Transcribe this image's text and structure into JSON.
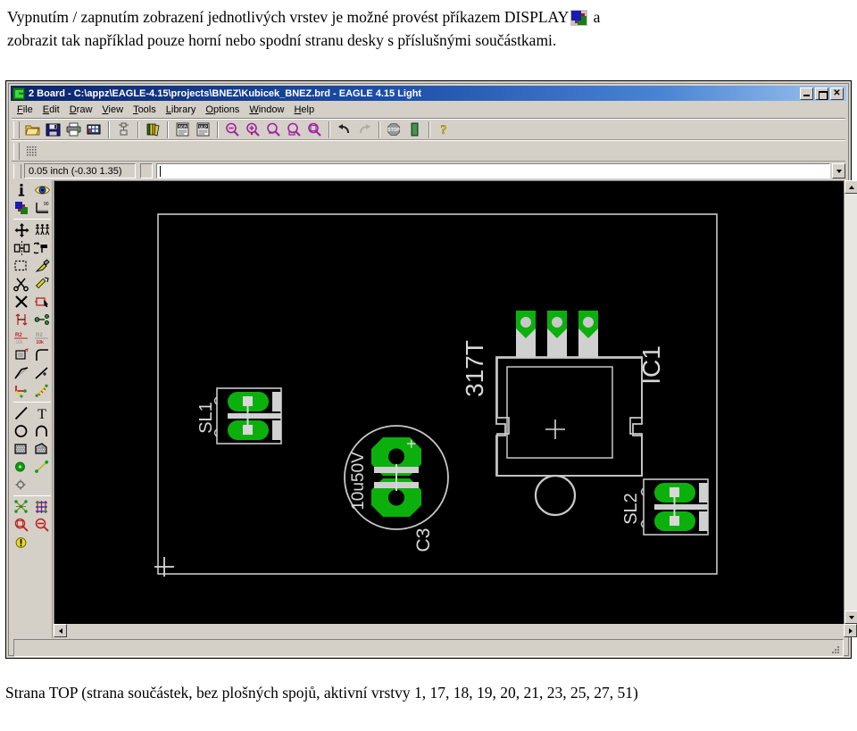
{
  "document": {
    "intro_text_line1": "Vypnutím / zapnutím zobrazení jednotlivých vrstev je možné provést příkazem DISPLAY",
    "intro_text_after_icon": " a",
    "intro_text_line2": "zobrazit tak například pouze horní nebo spodní stranu desky s příslušnými součástkami.",
    "caption_bottom": "Strana TOP (strana součástek, bez plošných spojů, aktivní vrstvy 1, 17, 18, 19, 20, 21, 23, 25, 27, 51)",
    "display_icon_name": "display-layers-icon"
  },
  "window": {
    "title": "2 Board - C:\\appz\\EAGLE-4.15\\projects\\BNEZ\\Kubicek_BNEZ.brd - EAGLE 4.15 Light",
    "app_icon": "eagle-icon",
    "buttons": {
      "minimize": "_",
      "maximize": "□",
      "close": "✕"
    }
  },
  "menubar": {
    "items": [
      {
        "label": "File",
        "accel": "F"
      },
      {
        "label": "Edit",
        "accel": "E"
      },
      {
        "label": "Draw",
        "accel": "D"
      },
      {
        "label": "View",
        "accel": "V"
      },
      {
        "label": "Tools",
        "accel": "T"
      },
      {
        "label": "Library",
        "accel": "L"
      },
      {
        "label": "Options",
        "accel": "O"
      },
      {
        "label": "Window",
        "accel": "W"
      },
      {
        "label": "Help",
        "accel": "H"
      }
    ]
  },
  "toolbar": {
    "groups": [
      {
        "items": [
          {
            "name": "open-icon",
            "label": "Open"
          },
          {
            "name": "save-icon",
            "label": "Save"
          },
          {
            "name": "print-icon",
            "label": "Print"
          },
          {
            "name": "cam-processor-icon",
            "label": "CAM Processor"
          }
        ]
      },
      {
        "items": [
          {
            "name": "board-schematic-switch-icon",
            "label": "Board/Schematic"
          }
        ]
      },
      {
        "items": [
          {
            "name": "library-icon",
            "label": "Library"
          }
        ]
      },
      {
        "items": [
          {
            "name": "script-icon",
            "label": "SCR"
          },
          {
            "name": "ulp-icon",
            "label": "ULP"
          }
        ]
      },
      {
        "items": [
          {
            "name": "zoom-out-icon",
            "label": "Zoom Out"
          },
          {
            "name": "zoom-in-icon",
            "label": "Zoom In"
          },
          {
            "name": "zoom-fit-icon",
            "label": "Zoom to Fit"
          },
          {
            "name": "zoom-select-icon",
            "label": "Zoom Select"
          },
          {
            "name": "redraw-icon",
            "label": "Redraw"
          }
        ]
      },
      {
        "items": [
          {
            "name": "undo-icon",
            "label": "Undo"
          },
          {
            "name": "redo-icon",
            "label": "Redo"
          }
        ]
      },
      {
        "items": [
          {
            "name": "stop-icon",
            "label": "Stop"
          },
          {
            "name": "drc-run-icon",
            "label": "Run"
          }
        ]
      },
      {
        "items": [
          {
            "name": "help-icon",
            "label": "Help"
          }
        ]
      }
    ],
    "second_row": [
      {
        "name": "grid-icon",
        "label": "Grid"
      }
    ]
  },
  "coordbar": {
    "coordinate_value": "0.05 inch (-0.30 1.35)",
    "command_value": "",
    "command_placeholder": ""
  },
  "tool_palette": {
    "groups": [
      {
        "tools": [
          {
            "name": "info-icon",
            "label": "Info"
          },
          {
            "name": "show-eye-icon",
            "label": "Show"
          },
          {
            "name": "display-layers-icon",
            "label": "Display"
          },
          {
            "name": "mark-icon",
            "label": "Mark"
          }
        ]
      },
      {
        "tools": [
          {
            "name": "move-icon",
            "label": "Move"
          },
          {
            "name": "group-icon",
            "label": "Group"
          },
          {
            "name": "mirror-icon",
            "label": "Mirror"
          },
          {
            "name": "rotate-icon",
            "label": "Rotate"
          },
          {
            "name": "change-icon",
            "label": "Change"
          },
          {
            "name": "paste-icon",
            "label": "Paste"
          },
          {
            "name": "cut-icon",
            "label": "Cut"
          },
          {
            "name": "copy-icon",
            "label": "Copy"
          },
          {
            "name": "delete-icon",
            "label": "Delete"
          },
          {
            "name": "add-icon",
            "label": "Add"
          },
          {
            "name": "pinswap-icon",
            "label": "Pinswap"
          },
          {
            "name": "replace-icon",
            "label": "Replace"
          },
          {
            "name": "name-icon",
            "label": "Name"
          },
          {
            "name": "value-icon",
            "label": "Value"
          },
          {
            "name": "smash-icon",
            "label": "Smash"
          },
          {
            "name": "miter-icon",
            "label": "Miter"
          },
          {
            "name": "split-icon",
            "label": "Split"
          },
          {
            "name": "optimize-icon",
            "label": "Optimize"
          },
          {
            "name": "route-icon",
            "label": "Route"
          },
          {
            "name": "ripup-icon",
            "label": "Ripup"
          }
        ]
      },
      {
        "tools": [
          {
            "name": "wire-icon",
            "label": "Wire"
          },
          {
            "name": "text-icon",
            "label": "Text"
          },
          {
            "name": "circle-icon",
            "label": "Circle"
          },
          {
            "name": "arc-icon",
            "label": "Arc"
          },
          {
            "name": "rect-icon",
            "label": "Rect"
          },
          {
            "name": "polygon-icon",
            "label": "Polygon"
          },
          {
            "name": "via-icon",
            "label": "Via"
          },
          {
            "name": "signal-icon",
            "label": "Signal"
          },
          {
            "name": "hole-icon",
            "label": "Hole"
          }
        ]
      },
      {
        "tools": [
          {
            "name": "ratsnest-icon",
            "label": "Ratsnest"
          },
          {
            "name": "auto-router-icon",
            "label": "Auto"
          },
          {
            "name": "drc-icon",
            "label": "DRC"
          },
          {
            "name": "errors-icon",
            "label": "Errors"
          },
          {
            "name": "erc-icon",
            "label": "ERC"
          }
        ]
      }
    ]
  },
  "statusbar": {
    "text": ""
  },
  "board": {
    "background_color": "#000000",
    "outline_color": "#d0d0d0",
    "pad_color": "#00b000",
    "silk_color": "#d8d8d8",
    "components": [
      {
        "name": "SL1",
        "label": "SL1",
        "type": "connector-2pin"
      },
      {
        "name": "C3",
        "label": "C3",
        "value": "10u50V",
        "polarity": "+",
        "type": "electrolytic-capacitor"
      },
      {
        "name": "IC1",
        "label": "IC1",
        "value": "317T",
        "type": "to220-regulator"
      },
      {
        "name": "SL2",
        "label": "SL2",
        "type": "connector-2pin"
      }
    ],
    "origin_marker": "origin-cross"
  }
}
